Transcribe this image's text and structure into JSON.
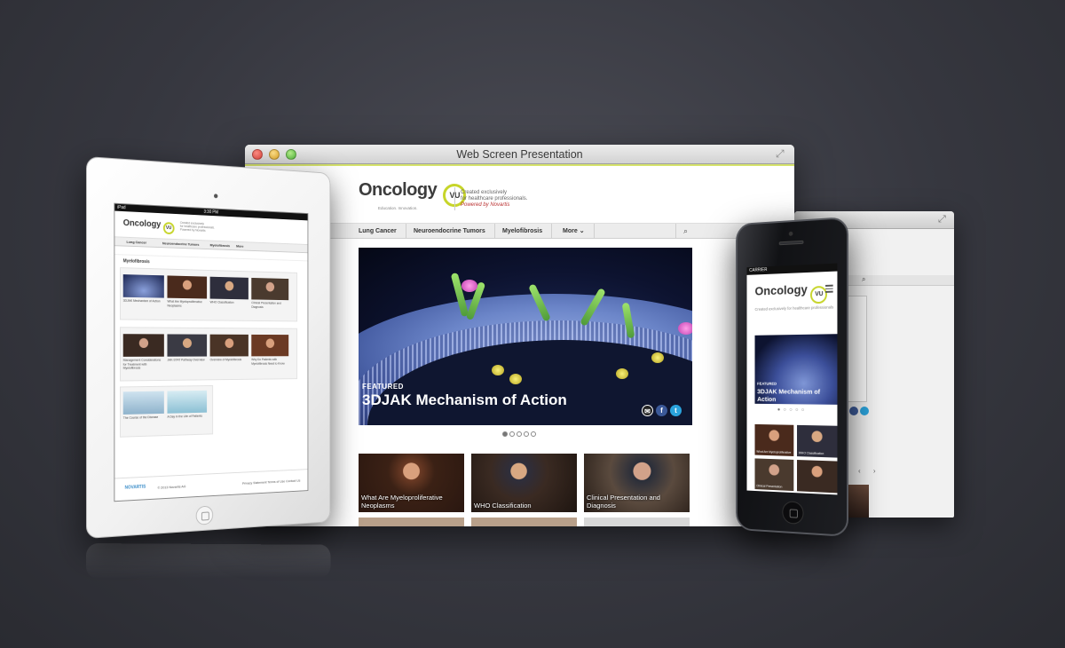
{
  "window": {
    "title": "Web Screen Presentation"
  },
  "site": {
    "logo": "Oncology",
    "logo_badge": "VU",
    "tagline": "Education. Innovation.",
    "header_note_line1": "Created exclusively",
    "header_note_line2": "for healthcare professionals.",
    "header_note_line3": "Powered by Novartis",
    "nav": [
      {
        "label": "Lung Cancer"
      },
      {
        "label": "Neuroendocrine Tumors"
      },
      {
        "label": "Myelofibrosis"
      },
      {
        "label": "More"
      }
    ],
    "hero": {
      "kicker": "FEATURED",
      "title": "3DJAK Mechanism of Action"
    },
    "videos": [
      {
        "label": "What Are Myeloproliferative Neoplasms"
      },
      {
        "label": "WHO Classification"
      },
      {
        "label": "Clinical Presentation and Diagnosis"
      }
    ]
  },
  "ipad": {
    "status_carrier": "iPad",
    "status_time": "3:30 PM",
    "nav": [
      "Lung Cancer",
      "Neuroendocrine Tumors",
      "Myelofibrosis",
      "More"
    ],
    "section_title": "Myelofibrosis",
    "row1": [
      {
        "label": "3DJAK Mechanism of Action"
      },
      {
        "label": "What Are Myeloproliferative Neoplasms"
      },
      {
        "label": "WHO Classification"
      },
      {
        "label": "Clinical Presentation and Diagnosis"
      }
    ],
    "row2": [
      {
        "label": "Management Considerations for Treatment with Myelofibrosis"
      },
      {
        "label": "JAK-STAT Pathway Overview"
      },
      {
        "label": "Overview of Myelofibrosis"
      },
      {
        "label": "Why Do Patients with Myelofibrosis Need to Know"
      }
    ],
    "row3": [
      {
        "label": "The Course of the Disease"
      },
      {
        "label": "A Day in the Life of Patients"
      }
    ],
    "footer_brand": "NOVARTIS",
    "footer_copy": "© 2013 Novartis AG",
    "footer_links": "Privacy Statement   Terms of Use   Contact Us"
  },
  "iphone": {
    "status": "CARRIER",
    "note": "Created exclusively for healthcare professionals",
    "hero_kicker": "FEATURED",
    "hero_title": "3DJAK Mechanism of Action",
    "thumbs": [
      {
        "label": "What Are Myeloproliferative"
      },
      {
        "label": "WHO Classification"
      },
      {
        "label": "Clinical Presentation"
      },
      {
        "label": ""
      }
    ]
  },
  "colors": {
    "accent_lime": "#c7d52a",
    "facebook": "#3b5998",
    "twitter": "#2aa3dc",
    "email": "#222222"
  },
  "icons": [
    "search-icon",
    "chevron-down-icon",
    "email-icon",
    "facebook-icon",
    "twitter-icon",
    "expand-icon",
    "menu-icon"
  ]
}
